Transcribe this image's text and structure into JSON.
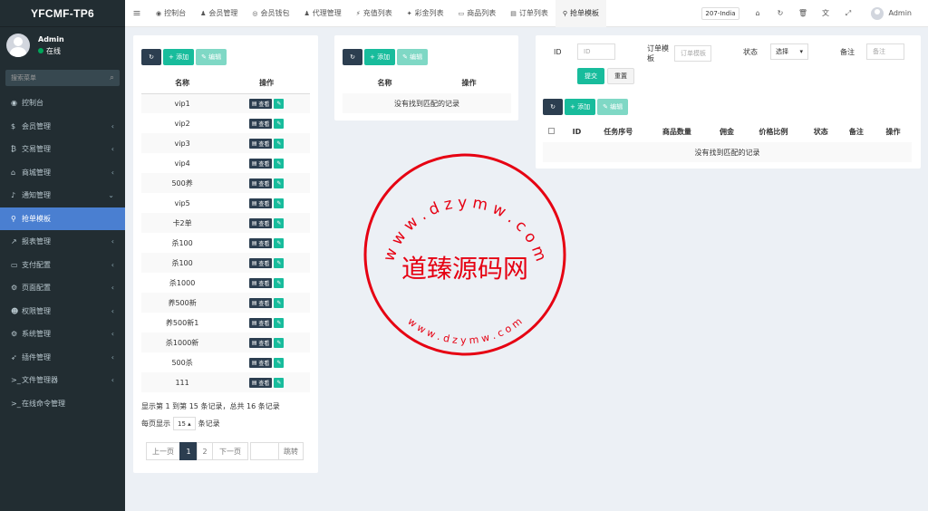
{
  "sidebar": {
    "logo": "YFCMF-TP6",
    "user": {
      "name": "Admin",
      "status": "在线"
    },
    "search_placeholder": "搜索菜单",
    "items": [
      {
        "label": "控制台",
        "icon": "dashboard-icon",
        "glyph": "◉",
        "chevron": ""
      },
      {
        "label": "会员管理",
        "icon": "dollar-icon",
        "glyph": "$",
        "chevron": "‹"
      },
      {
        "label": "交易管理",
        "icon": "bitcoin-icon",
        "glyph": "₿",
        "chevron": "‹"
      },
      {
        "label": "商城管理",
        "icon": "home-icon",
        "glyph": "⌂",
        "chevron": "‹"
      },
      {
        "label": "通知管理",
        "icon": "bell-icon",
        "glyph": "♪",
        "chevron": "⌄"
      },
      {
        "label": "抢单模板",
        "icon": "sitemap-icon",
        "glyph": "⚲",
        "chevron": ""
      },
      {
        "label": "报表管理",
        "icon": "line-chart-icon",
        "glyph": "↗",
        "chevron": "‹"
      },
      {
        "label": "支付配置",
        "icon": "credit-card-icon",
        "glyph": "▭",
        "chevron": "‹"
      },
      {
        "label": "页面配置",
        "icon": "gear-icon",
        "glyph": "⚙",
        "chevron": "‹"
      },
      {
        "label": "权限管理",
        "icon": "users-icon",
        "glyph": "☻",
        "chevron": "‹"
      },
      {
        "label": "系统管理",
        "icon": "cogs-icon",
        "glyph": "⚙",
        "chevron": "‹"
      },
      {
        "label": "插件管理",
        "icon": "rocket-icon",
        "glyph": "➶",
        "chevron": "‹"
      },
      {
        "label": "文件管理器",
        "icon": "terminal-icon",
        "glyph": ">_",
        "chevron": "‹"
      },
      {
        "label": "在线命令管理",
        "icon": "terminal-icon",
        "glyph": ">_",
        "chevron": ""
      }
    ]
  },
  "topbar": {
    "tabs": [
      {
        "label": "控制台",
        "glyph": "◉",
        "icon": "dashboard-icon"
      },
      {
        "label": "会员管理",
        "glyph": "♟",
        "icon": "user-icon"
      },
      {
        "label": "会员钱包",
        "glyph": "◎",
        "icon": "wallet-icon"
      },
      {
        "label": "代理管理",
        "glyph": "♟",
        "icon": "user-icon"
      },
      {
        "label": "充值列表",
        "glyph": "⚡",
        "icon": "bolt-icon"
      },
      {
        "label": "彩金列表",
        "glyph": "✦",
        "icon": "gift-icon"
      },
      {
        "label": "商品列表",
        "glyph": "▭",
        "icon": "monitor-icon"
      },
      {
        "label": "订单列表",
        "glyph": "▤",
        "icon": "list-icon"
      },
      {
        "label": "抢单模板",
        "glyph": "⚲",
        "icon": "sitemap-icon"
      }
    ],
    "region": "207-India",
    "user": "Admin"
  },
  "left_panel": {
    "add_label": "+ 添加",
    "edit_label": "✎ 编辑",
    "col_name": "名称",
    "col_ops": "操作",
    "view_label": "查看",
    "rows": [
      "vip1",
      "vip2",
      "vip3",
      "vip4",
      "500养",
      "vip5",
      "卡2单",
      "杀100",
      "杀100",
      "杀1000",
      "养500新",
      "养500新1",
      "杀1000新",
      "500杀",
      "111"
    ],
    "summary": "显示第 1 到第 15 条记录，总共 16 条记录",
    "per_page_prefix": "每页显示",
    "per_page_value": "15",
    "per_page_suffix": "条记录",
    "pager": {
      "prev": "上一页",
      "p1": "1",
      "p2": "2",
      "next": "下一页",
      "jump": "跳转"
    }
  },
  "middle_panel": {
    "add_label": "+ 添加",
    "edit_label": "✎ 编辑",
    "col_name": "名称",
    "col_ops": "操作",
    "empty": "没有找到匹配的记录"
  },
  "right_panel": {
    "form": {
      "id_label": "ID",
      "id_placeholder": "ID",
      "template_label": "订单模板",
      "template_placeholder": "订单模板",
      "status_label": "状态",
      "status_value": "选择",
      "remark_label": "备注",
      "remark_placeholder": "备注",
      "submit": "提交",
      "reset": "重置"
    },
    "add_label": "+ 添加",
    "edit_label": "✎ 编辑",
    "columns": [
      "ID",
      "任务序号",
      "商品数量",
      "佣金",
      "价格比例",
      "状态",
      "备注",
      "操作"
    ],
    "empty": "没有找到匹配的记录"
  },
  "watermark": {
    "top_arc": "w w w . d z y m w . c o m",
    "bottom_arc": "w w w . d z y m w . c o m",
    "center": "道臻源码网",
    "color": "#e60012"
  }
}
